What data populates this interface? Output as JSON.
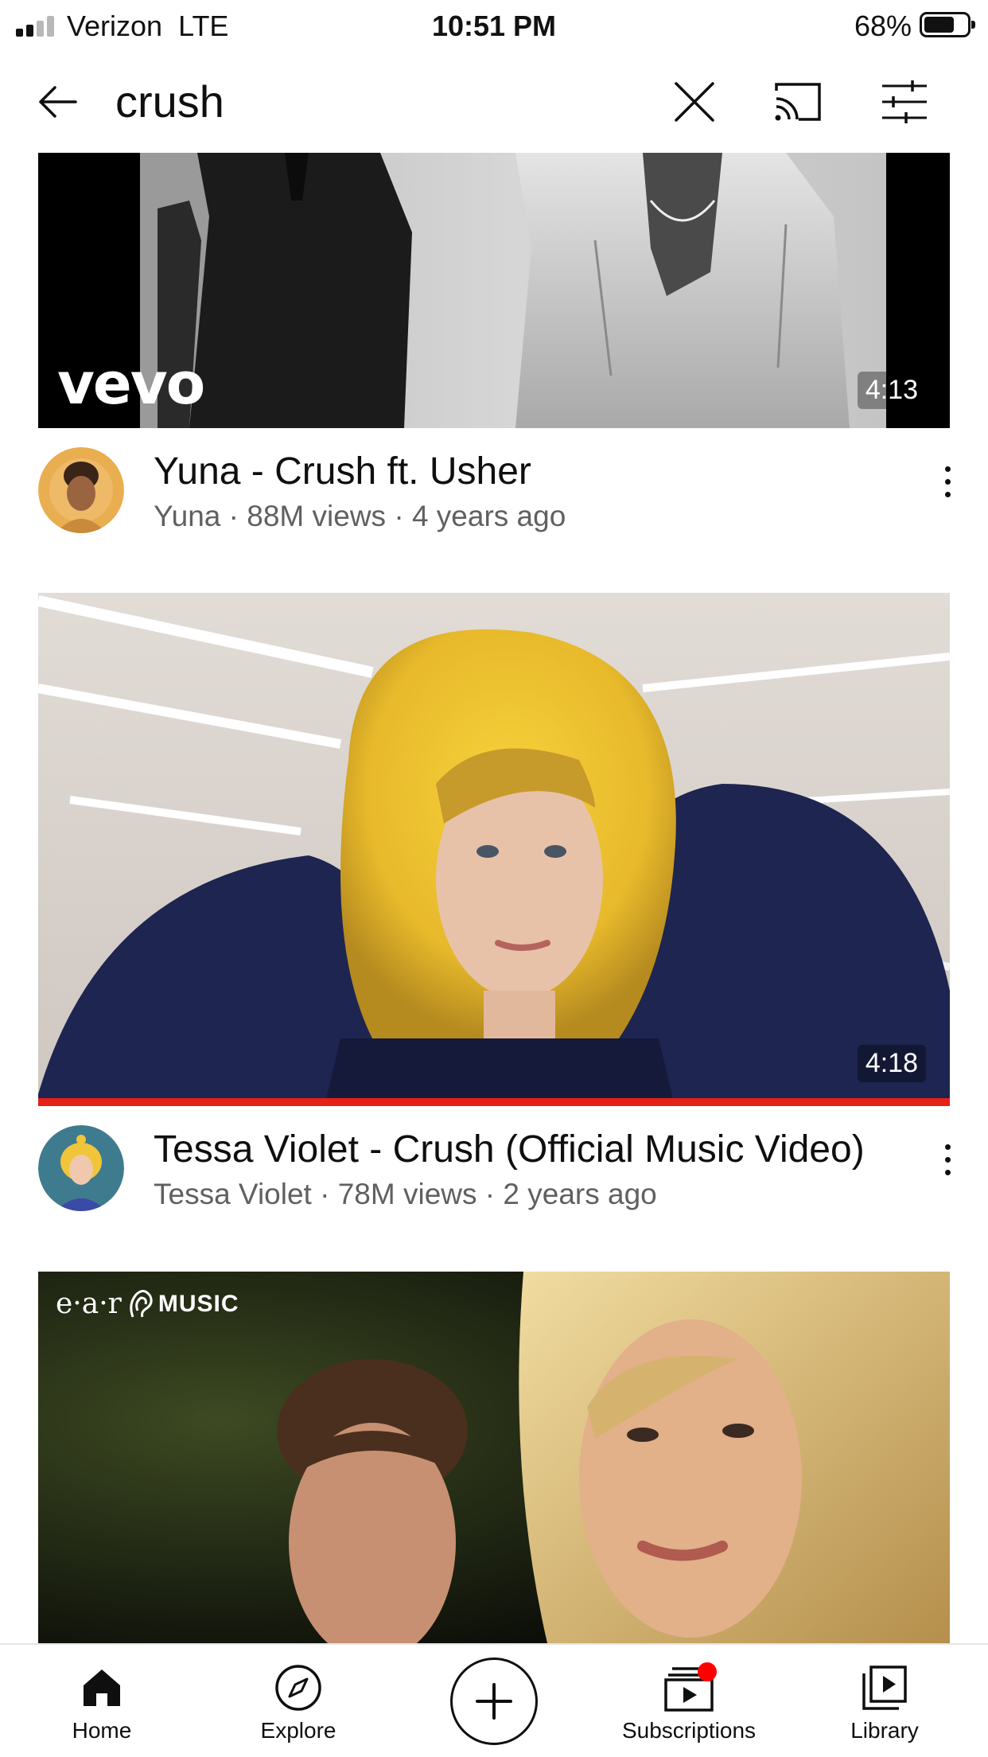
{
  "status_bar": {
    "carrier": "Verizon",
    "network": "LTE",
    "time": "10:51 PM",
    "battery": "68%",
    "battery_level": 0.68,
    "signal_bars_active": 2,
    "signal_bars_total": 4
  },
  "search": {
    "query": "crush",
    "back_icon": "back-arrow-icon",
    "clear_icon": "close-icon",
    "cast_icon": "cast-icon",
    "filter_icon": "filter-sliders-icon"
  },
  "videos": [
    {
      "title": "Yuna - Crush ft. Usher",
      "channel": "Yuna",
      "views": "88M views",
      "age": "4 years ago",
      "separator": " · ",
      "duration": "4:13",
      "thumbnail_logo": "vevo",
      "watched_progress": 0
    },
    {
      "title": "Tessa Violet - Crush (Official Music Video)",
      "channel": "Tessa Violet",
      "views": "78M views",
      "age": "2 years ago",
      "separator": " · ",
      "duration": "4:18",
      "watched_progress": 1.0
    },
    {
      "thumbnail_logo_prefix": "e·a·r",
      "thumbnail_logo_suffix": "MUSIC"
    }
  ],
  "bottom_nav": {
    "items": [
      {
        "label": "Home",
        "icon": "home-icon"
      },
      {
        "label": "Explore",
        "icon": "compass-icon"
      },
      {
        "label": "",
        "icon": "create-plus-icon"
      },
      {
        "label": "Subscriptions",
        "icon": "subscriptions-icon",
        "badge": true
      },
      {
        "label": "Library",
        "icon": "library-icon"
      }
    ]
  },
  "colors": {
    "progress_bar": "#e62117",
    "badge": "#ff0000",
    "secondary_text": "#606060"
  }
}
